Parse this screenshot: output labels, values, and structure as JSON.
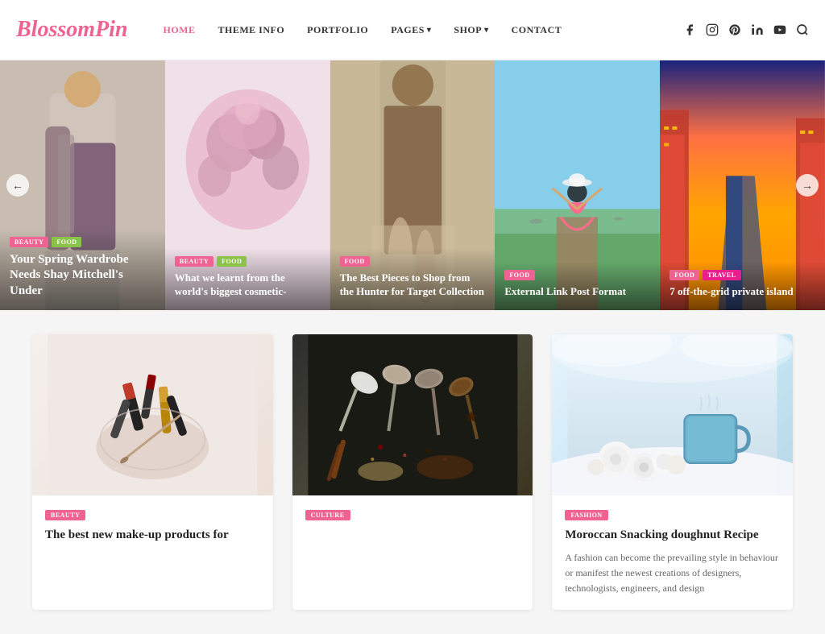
{
  "header": {
    "logo_text": "Blossom",
    "logo_accent": "Pin",
    "nav": [
      {
        "label": "HOME",
        "active": true,
        "has_dropdown": false
      },
      {
        "label": "THEME INFO",
        "active": false,
        "has_dropdown": false
      },
      {
        "label": "PORTFOLIO",
        "active": false,
        "has_dropdown": false
      },
      {
        "label": "PAGES",
        "active": false,
        "has_dropdown": true
      },
      {
        "label": "SHOP",
        "active": false,
        "has_dropdown": true
      },
      {
        "label": "CONTACT",
        "active": false,
        "has_dropdown": false
      }
    ],
    "social_icons": [
      "facebook",
      "instagram",
      "pinterest",
      "linkedin",
      "youtube"
    ],
    "search_icon": "search"
  },
  "slider": {
    "prev_label": "←",
    "next_label": "→",
    "slides": [
      {
        "tags": [
          "BEAUTY",
          "FOOD"
        ],
        "title": "Your Spring Wardrobe Needs Shay Mitchell's Under"
      },
      {
        "tags": [
          "BEAUTY",
          "FOOD"
        ],
        "title": "What we learnt from the world's biggest cosmetic-"
      },
      {
        "tags": [
          "FOOD"
        ],
        "title": "The Best Pieces to Shop from the Hunter for Target Collection"
      },
      {
        "tags": [
          "FOOD"
        ],
        "title": "External Link Post Format"
      },
      {
        "tags": [
          "FOOD",
          "TRAVEL"
        ],
        "title": "7 off-the-grid private island"
      }
    ]
  },
  "posts": [
    {
      "tag": "BEAUTY",
      "tag_color": "#f06292",
      "title": "The best new make-up products for",
      "excerpt": "",
      "img_emoji": "💄"
    },
    {
      "tag": "CULTURE",
      "tag_color": "#f06292",
      "title": "",
      "excerpt": "",
      "img_emoji": "🥄"
    },
    {
      "tag": "FASHION",
      "tag_color": "#f06292",
      "title": "Moroccan Snacking doughnut Recipe",
      "excerpt": "A fashion can become the prevailing style in behaviour or manifest the newest creations of designers, technologists, engineers, and design",
      "img_emoji": "☕"
    }
  ]
}
